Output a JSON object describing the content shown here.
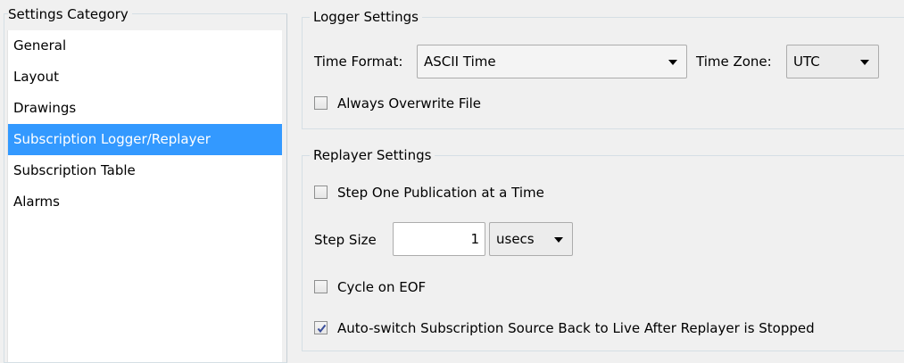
{
  "category_panel": {
    "title": "Settings Category",
    "items": [
      {
        "label": "General",
        "selected": false
      },
      {
        "label": "Layout",
        "selected": false
      },
      {
        "label": "Drawings",
        "selected": false
      },
      {
        "label": "Subscription Logger/Replayer",
        "selected": true
      },
      {
        "label": "Subscription Table",
        "selected": false
      },
      {
        "label": "Alarms",
        "selected": false
      }
    ]
  },
  "logger": {
    "title": "Logger Settings",
    "time_format_label": "Time Format:",
    "time_format_value": "ASCII Time",
    "time_zone_label": "Time Zone:",
    "time_zone_value": "UTC",
    "overwrite_label": "Always Overwrite File",
    "overwrite_checked": false
  },
  "replayer": {
    "title": "Replayer Settings",
    "step_one_label": "Step One Publication at a Time",
    "step_one_checked": false,
    "step_size_label": "Step Size",
    "step_size_value": "1",
    "step_unit_value": "usecs",
    "cycle_label": "Cycle on EOF",
    "cycle_checked": false,
    "autoswitch_label": "Auto-switch Subscription Source Back to Live After Replayer is Stopped",
    "autoswitch_checked": true
  },
  "colors": {
    "selection": "#3399ff",
    "background": "#f0f0f0",
    "checkmark": "#3a4e9a"
  }
}
